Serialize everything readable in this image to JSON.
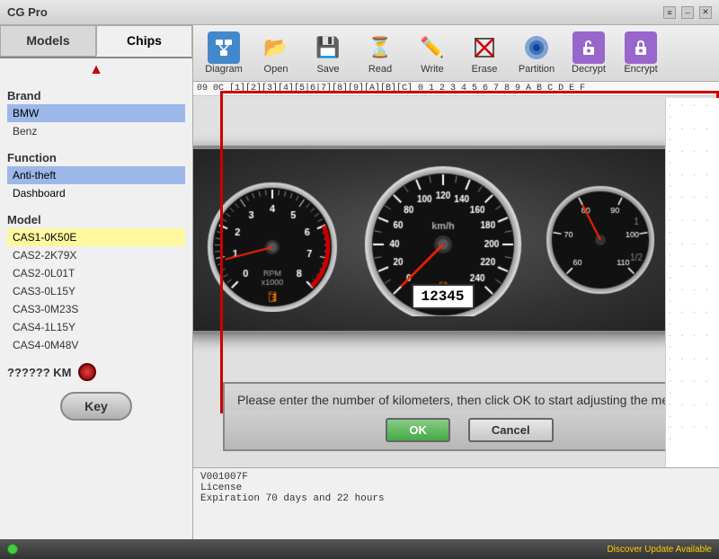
{
  "titleBar": {
    "title": "CG Pro",
    "controls": [
      "≡",
      "–",
      "✕"
    ]
  },
  "sidebar": {
    "tabs": [
      {
        "label": "Models",
        "active": false
      },
      {
        "label": "Chips",
        "active": true
      }
    ],
    "brand": {
      "title": "Brand",
      "items": [
        {
          "label": "BMW",
          "selected": true
        },
        {
          "label": "Benz",
          "selected": false
        }
      ]
    },
    "function": {
      "title": "Function",
      "items": [
        {
          "label": "Anti-theft",
          "selected": true
        },
        {
          "label": "Dashboard",
          "selected": false
        }
      ]
    },
    "model": {
      "title": "Model",
      "items": [
        {
          "label": "CAS1-0K50E",
          "selected": true
        },
        {
          "label": "CAS2-2K79X"
        },
        {
          "label": "CAS2-0L01T"
        },
        {
          "label": "CAS3-0L15Y"
        },
        {
          "label": "CAS3-0M23S"
        },
        {
          "label": "CAS4-1L15Y"
        },
        {
          "label": "CAS4-0M48V"
        }
      ]
    },
    "kmLabel": "?????? KM",
    "keyLabel": "Key"
  },
  "toolbar": {
    "buttons": [
      {
        "label": "Diagram",
        "icon": "diagram"
      },
      {
        "label": "Open",
        "icon": "📂"
      },
      {
        "label": "Save",
        "icon": "💾"
      },
      {
        "label": "Read",
        "icon": "⏳"
      },
      {
        "label": "Write",
        "icon": "✏️"
      },
      {
        "label": "Erase",
        "icon": "✖"
      },
      {
        "label": "Partition",
        "icon": "🔵"
      },
      {
        "label": "Decrypt",
        "icon": "🔓"
      },
      {
        "label": "Encrypt",
        "icon": "🔒"
      }
    ]
  },
  "hexRow": "09 0C  [1][2][3][4][5|6|7][8][9][A][B][C]  0 1 2 3 4 5 6 7 8 9 A B C D E F",
  "dialog": {
    "inputValue": "12345",
    "message": "Please enter the number of kilometers, then click OK to start adjusting the meter.",
    "okLabel": "OK",
    "cancelLabel": "Cancel"
  },
  "statusBar": {
    "lines": [
      "V001007F",
      "License",
      "Expiration 70 days and 22 hours"
    ]
  },
  "footer": {
    "updateText": "Discover Update Available"
  }
}
